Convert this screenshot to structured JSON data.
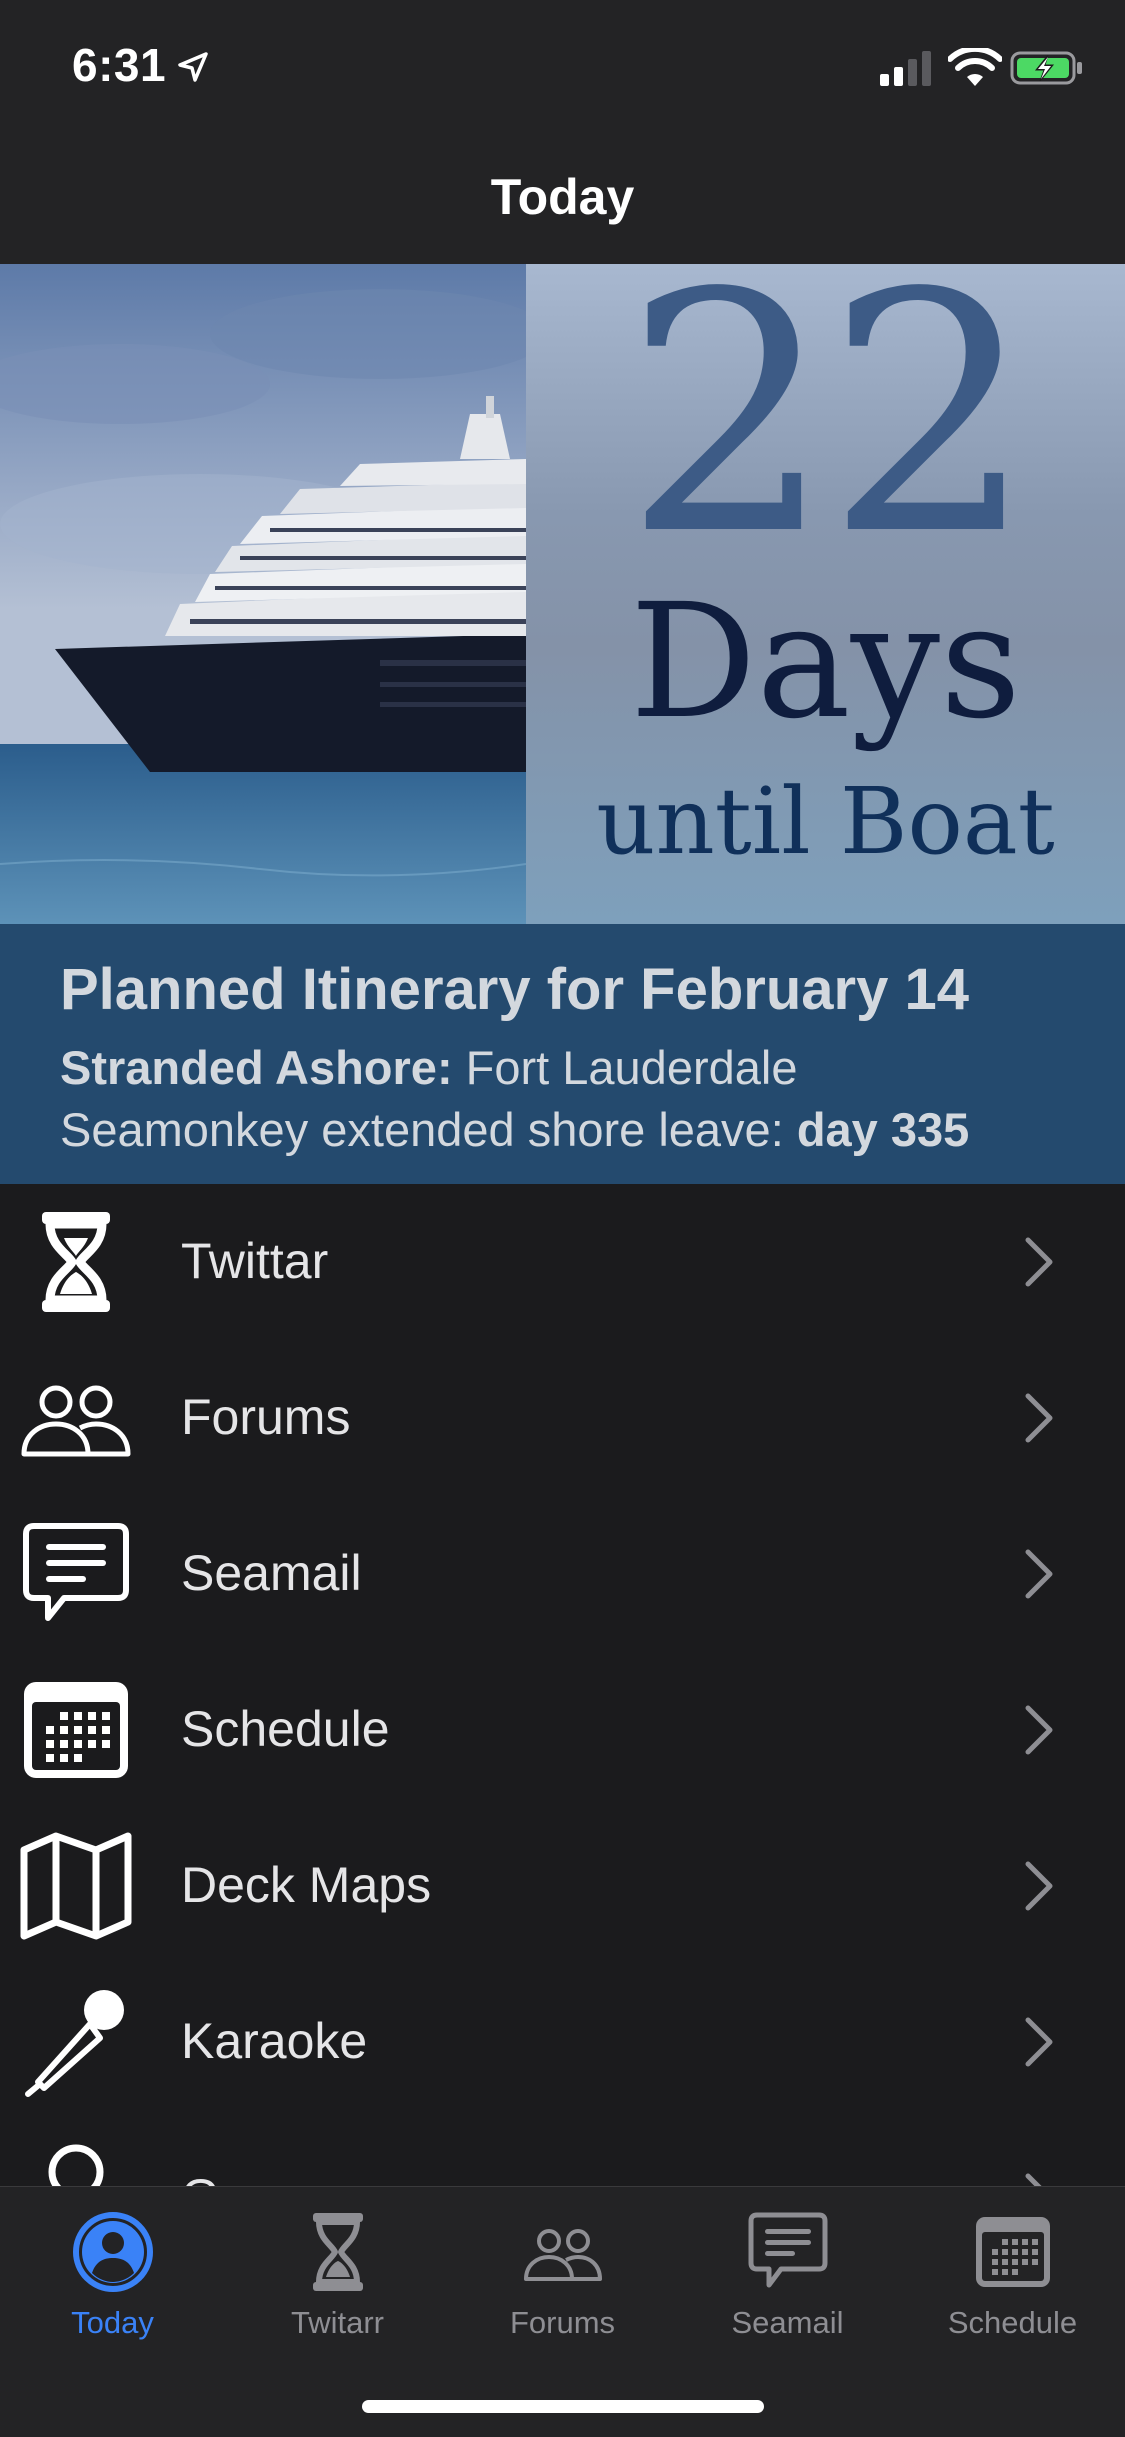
{
  "status_bar": {
    "time": "6:31"
  },
  "nav": {
    "title": "Today"
  },
  "banner": {
    "countdown_number": "22",
    "countdown_unit": "Days",
    "countdown_caption": "until Boat"
  },
  "itinerary": {
    "title": "Planned Itinerary for February 14",
    "line1_label": "Stranded Ashore:",
    "line1_value": " Fort Lauderdale",
    "line2_text": "Seamonkey extended shore leave: ",
    "line2_value": "day 335"
  },
  "menu": {
    "items": [
      {
        "label": "Twittar",
        "icon": "hourglass-icon"
      },
      {
        "label": "Forums",
        "icon": "people-icon"
      },
      {
        "label": "Seamail",
        "icon": "chat-bubble-icon"
      },
      {
        "label": "Schedule",
        "icon": "calendar-icon"
      },
      {
        "label": "Deck Maps",
        "icon": "map-icon"
      },
      {
        "label": "Karaoke",
        "icon": "microphone-icon"
      },
      {
        "label": "G...",
        "icon": "person-icon"
      }
    ]
  },
  "tab_bar": {
    "active_color": "#3a82f7",
    "inactive_color": "#8e8e93",
    "tabs": [
      {
        "label": "Today",
        "icon": "person-circle-icon",
        "active": true
      },
      {
        "label": "Twitarr",
        "icon": "hourglass-icon",
        "active": false
      },
      {
        "label": "Forums",
        "icon": "people-icon",
        "active": false
      },
      {
        "label": "Seamail",
        "icon": "chat-bubble-icon",
        "active": false
      },
      {
        "label": "Schedule",
        "icon": "calendar-icon",
        "active": false
      }
    ]
  }
}
